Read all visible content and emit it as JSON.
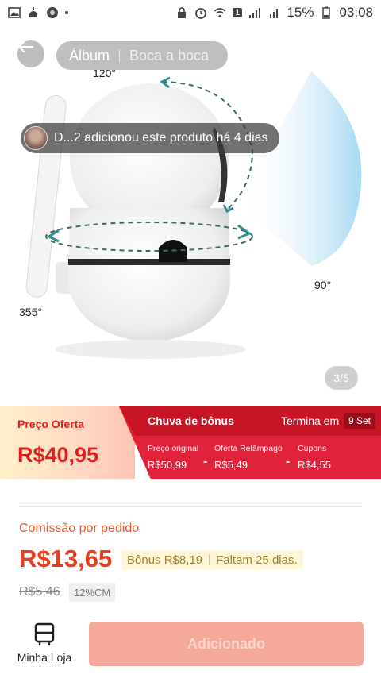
{
  "status_bar": {
    "battery_percent": "15%",
    "time": "03:08",
    "sim_badge": "1"
  },
  "gallery": {
    "tabs": [
      {
        "label": "Álbum",
        "active": true
      },
      {
        "label": "Boca a boca",
        "active": false
      }
    ],
    "notification": "D...2 adicionou este produto há 4 dias",
    "angle_labels": {
      "top": "120°",
      "right": "90°",
      "left": "355°"
    },
    "page_counter": "3/5"
  },
  "price_banner": {
    "offer_label": "Preço Oferta",
    "offer_price": "R$40,95",
    "campaign_title": "Chuva de bônus",
    "ends_label": "Termina em",
    "ends_date": "9 Set",
    "breakdown": [
      {
        "label": "Preço original",
        "value": "R$50,99"
      },
      {
        "label": "Oferta Relâmpago",
        "value": "R$5,49"
      },
      {
        "label": "Cupons",
        "value": "R$4,55"
      }
    ],
    "minus_sign": "-",
    "colors": {
      "accent": "#e0233a",
      "accent_dark": "#c81526",
      "price": "#e0201f"
    }
  },
  "commission": {
    "label": "Comissão por pedido",
    "value": "R$13,65",
    "bonus": "Bônus R$8,19",
    "remaining": "Faltam 25 dias.",
    "old_value": "R$5,46",
    "rate": "12%CM"
  },
  "bottom_bar": {
    "store_label": "Minha Loja",
    "store_icon": "store-icon",
    "action_label": "Adicionado"
  }
}
